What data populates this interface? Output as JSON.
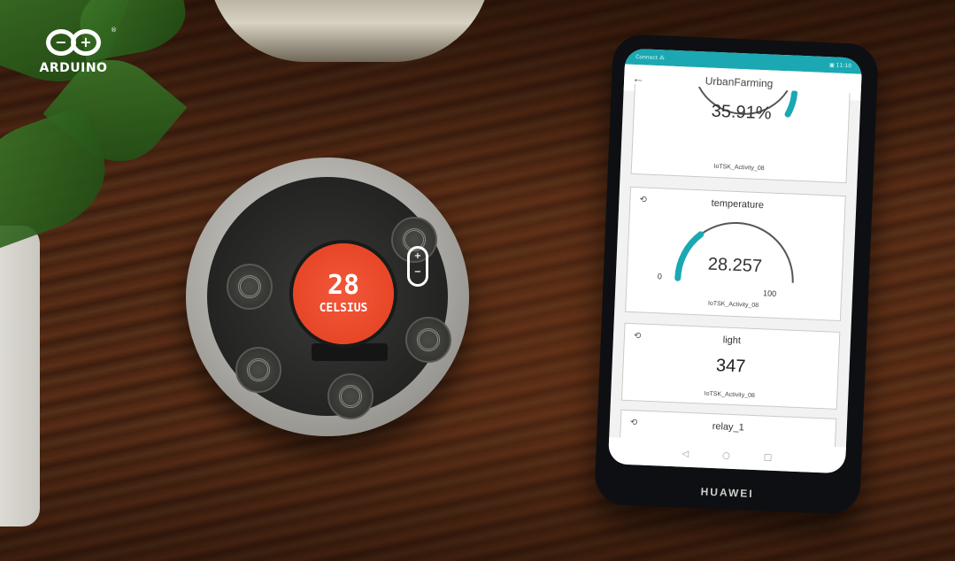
{
  "brand": {
    "text": "ARDUINO",
    "mark_left": "−",
    "mark_right": "+",
    "registered": "®"
  },
  "device": {
    "reading": "28",
    "unit": "CELSIUS"
  },
  "phone": {
    "maker": "HUAWEI",
    "status_left": "Connect ⁂",
    "status_right": "▣ 11:10",
    "app_title": "UrbanFarming",
    "back_icon": "arrow-left-icon",
    "cards": [
      {
        "title": "",
        "value": "35.91%",
        "fill_fraction": 0.359,
        "device": "IoTSK_Activity_08"
      },
      {
        "title": "temperature",
        "value": "28.257",
        "min": "0",
        "max": "100",
        "device": "IoTSK_Activity_08"
      },
      {
        "title": "light",
        "value": "347",
        "device": "IoTSK_Activity_08"
      },
      {
        "title": "relay_1"
      }
    ],
    "history_icon": "history-icon",
    "nav": [
      "◁",
      "○",
      "□"
    ],
    "accent": "#1ba8b2"
  }
}
